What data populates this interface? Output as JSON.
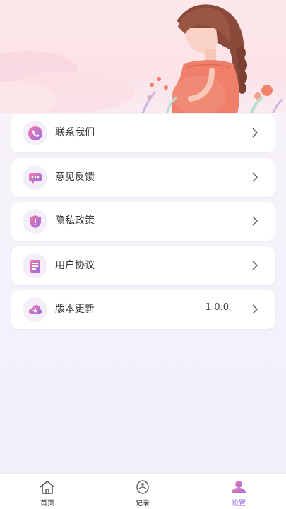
{
  "menu": {
    "items": [
      {
        "label": "联系我们",
        "icon": "phone-icon"
      },
      {
        "label": "意见反馈",
        "icon": "chat-icon"
      },
      {
        "label": "隐私政策",
        "icon": "shield-icon"
      },
      {
        "label": "用户协议",
        "icon": "document-icon"
      },
      {
        "label": "版本更新",
        "icon": "cloud-download-icon",
        "value": "1.0.0"
      }
    ]
  },
  "tabbar": {
    "tabs": [
      {
        "label": "首页",
        "icon": "home-icon",
        "active": false
      },
      {
        "label": "记录",
        "icon": "record-icon",
        "active": false
      },
      {
        "label": "设置",
        "icon": "profile-icon",
        "active": true
      }
    ]
  },
  "colors": {
    "accent": "#8c58d6",
    "icon_pink": "#f27aa8",
    "icon_purple": "#9b6be0",
    "header_pink": "#fde7ea"
  }
}
